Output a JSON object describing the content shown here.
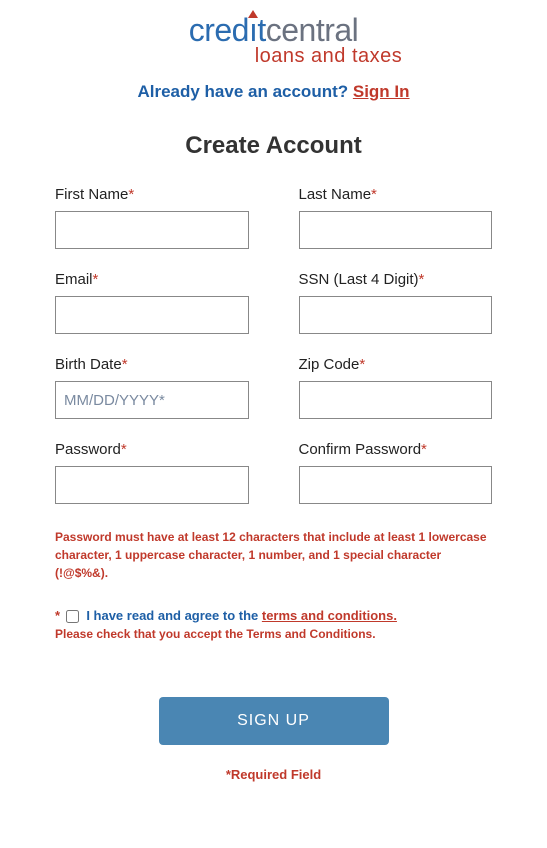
{
  "logo": {
    "part1": "cred",
    "part2_i": "ı",
    "part3": "t",
    "part4": "central",
    "sub": "loans and taxes"
  },
  "already": {
    "prefix": "Already have an account? ",
    "link": "Sign In"
  },
  "title": "Create Account",
  "fields": {
    "first_name": "First Name",
    "last_name": "Last Name",
    "email": "Email",
    "ssn": "SSN (Last 4 Digit)",
    "birth_date": "Birth Date",
    "birth_placeholder": "MM/DD/YYYY*",
    "zip": "Zip Code",
    "password": "Password",
    "confirm_password": "Confirm Password"
  },
  "star": "*",
  "pw_hint": "Password must have at least 12 characters that include at least 1 lowercase character, 1 uppercase character, 1 number, and 1 special character (!@$%&).",
  "agree": {
    "star": "*",
    "text": "I have read and agree to the ",
    "link": "terms and conditions.",
    "sub": "Please check that you accept the Terms and Conditions."
  },
  "submit": "SIGN UP",
  "req_note": "*Required Field"
}
